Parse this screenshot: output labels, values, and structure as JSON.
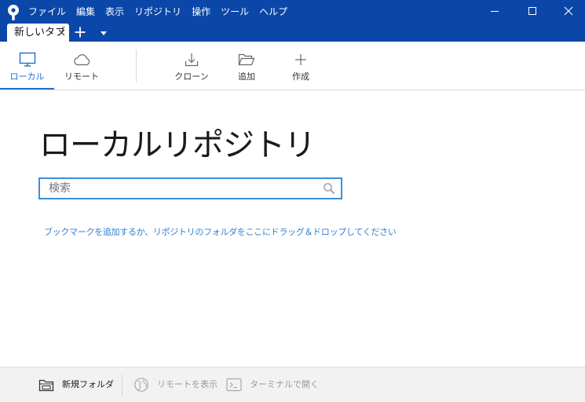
{
  "window": {
    "menu": [
      "ファイル",
      "編集",
      "表示",
      "リポジトリ",
      "操作",
      "ツール",
      "ヘルプ"
    ]
  },
  "tabs": [
    {
      "label": "新しいタブ"
    }
  ],
  "toolbar": {
    "local_label": "ローカル",
    "remote_label": "リモート",
    "clone_label": "クローン",
    "add_label": "追加",
    "create_label": "作成"
  },
  "main": {
    "title": "ローカルリポジトリ",
    "search_placeholder": "検索",
    "search_value": "",
    "hint": "ブックマークを追加するか、リポジトリのフォルダをここにドラッグ＆ドロップしてください"
  },
  "bottom": {
    "new_folder_label": "新規フォルダ",
    "show_remote_label": "リモートを表示",
    "open_terminal_label": "ターミナルで開く"
  },
  "colors": {
    "titlebar": "#0b47a8",
    "accent": "#1e6fd9",
    "link": "#2f7fd0",
    "search_border": "#3b8fd9",
    "disabled_text": "#9a9a9a"
  }
}
